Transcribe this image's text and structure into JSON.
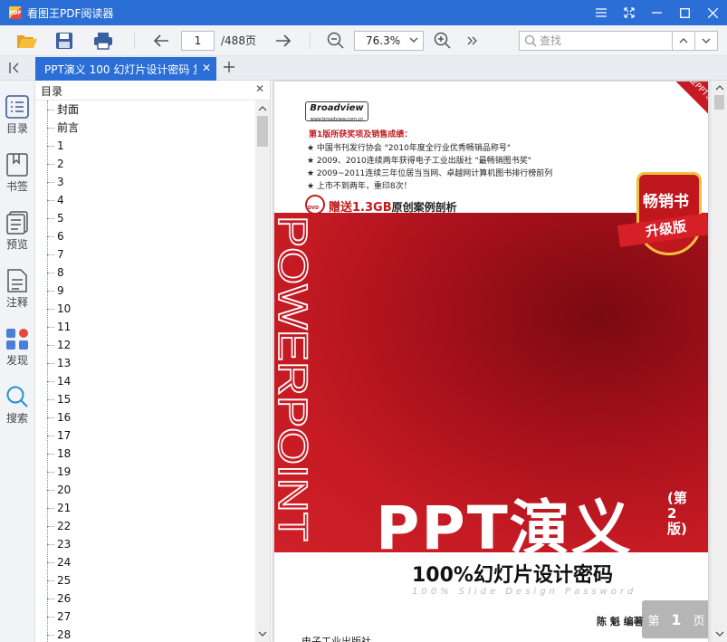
{
  "window": {
    "title": "看图王PDF阅读器",
    "logo_text": "PDF"
  },
  "toolbar": {
    "page_current": "1",
    "page_total": "/488页",
    "zoom": "76.3%",
    "search_placeholder": "查找"
  },
  "tab": {
    "title": "PPT演义 100 幻灯片设计密码 复"
  },
  "rail": {
    "items": [
      {
        "label": "目录"
      },
      {
        "label": "书签"
      },
      {
        "label": "预览"
      },
      {
        "label": "注释"
      },
      {
        "label": "发现"
      },
      {
        "label": "搜索"
      }
    ]
  },
  "outline": {
    "title": "目录",
    "items": [
      "封面",
      "前言",
      "1",
      "2",
      "3",
      "4",
      "5",
      "6",
      "7",
      "8",
      "9",
      "10",
      "11",
      "12",
      "13",
      "14",
      "15",
      "16",
      "17",
      "18",
      "19",
      "20",
      "21",
      "22",
      "23",
      "24",
      "25",
      "26",
      "27",
      "28"
    ]
  },
  "cover": {
    "brand": "Broadview",
    "brand_url": "www.broadview.com.cn",
    "awards_head": "第1版所获奖项及销售成绩：",
    "awards": [
      "★ 中国书刊发行协会 \"2010年度全行业优秀畅销品称号\"",
      "★ 2009、2010连续两年获得电子工业出版社 \"最畅销图书奖\"",
      "★ 2009~2011连续三年位居当当网、卓越网计算机图书排行榜前列",
      "★ 上市不到两年，重印8次！"
    ],
    "dvd_label": "DVD",
    "dvd_bonus": "赠送1.3GB",
    "dvd_bonus_tail": "原创案例剖析",
    "ribbon": "中国专业PPT领跑",
    "badge_top": "畅销书",
    "badge_bottom": "升级版",
    "vertical_word": "POWERPOINT",
    "title": "PPT演义",
    "edition": "(第2版)",
    "subtitle": "100%幻灯片设计密码",
    "subtitle_en": "100% Slide Design Password",
    "author": "陈 魁 编著",
    "publisher": "电子工业出版社"
  },
  "page_indicator": {
    "prefix": "第",
    "number": "1",
    "suffix": "页"
  }
}
